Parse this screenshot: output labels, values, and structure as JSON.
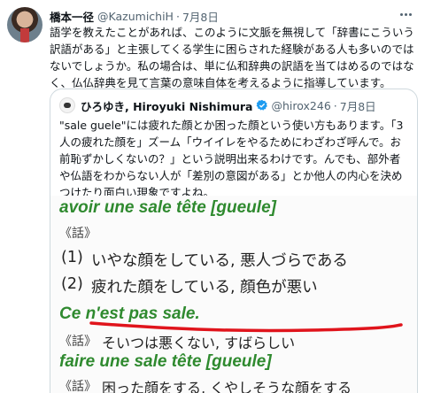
{
  "tweet": {
    "author_name": "橋本一径",
    "handle": "@KazumichiH",
    "dot": "·",
    "date": "7月8日",
    "text": "語学を教えたことがあれば、このように文脈を無視して「辞書にこういう訳語がある」と主張してくる学生に困らされた経験がある人も多いのではないでしょうか。私の場合は、単に仏和辞典の訳語を当てはめるのではなく、仏仏辞典を見て言葉の意味自体を考えるように指導しています。"
  },
  "quoted": {
    "author_name": "ひろゆき, Hiroyuki Nishimura",
    "handle": "@hirox246",
    "dot": "·",
    "date": "7月8日",
    "text": "\"sale guele\"には疲れた顔とか困った顔という使い方もあります。「3人の疲れた顔を」ズーム「ウイイレをやるためにわざわざ呼んで。お前恥ずかしくないの？」という説明出来るわけです。んでも、部外者や仏語をわからない人が「差別の意図がある」とか他人の内心を決めつけたり面白い現象ですよね。"
  },
  "dictionary": {
    "entry1": "avoir une sale tête [gueule]",
    "tag1": "《話》",
    "sense1_num": "(1)",
    "sense1_text": "いやな顔をしている, 悪人づらである",
    "sense2_num": "(2)",
    "sense2_text": "疲れた顔をしている, 顔色が悪い",
    "entry2": "Ce n'est pas sale.",
    "tag2": "《話》",
    "sense3_text": "そいつは悪くない, すばらしい",
    "entry3": "faire une sale tête [gueule]",
    "tag3": "《話》",
    "sense4_text": "困った顔をする, くやしそうな顔をする"
  },
  "colors": {
    "entry_green": "#2f8a2f",
    "underline_red": "#e0141c",
    "verified_blue": "#1d9bf0"
  }
}
